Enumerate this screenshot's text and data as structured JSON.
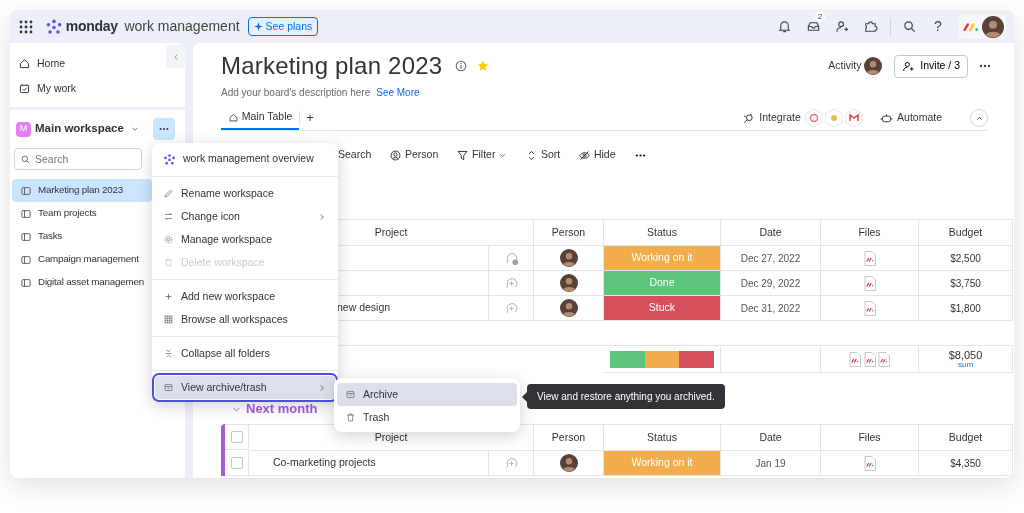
{
  "top_bar": {
    "brand": "monday",
    "product": "work management",
    "plans_button": "See plans",
    "inbox_badge": "2",
    "help": "?"
  },
  "sidebar": {
    "nav": [
      {
        "label": "Home"
      },
      {
        "label": "My work"
      }
    ],
    "workspace": {
      "initial": "M",
      "name": "Main workspace",
      "menu_open": true
    },
    "search": {
      "placeholder": "Search"
    },
    "boards": [
      {
        "label": "Marketing plan 2023",
        "selected": true
      },
      {
        "label": "Team projects",
        "selected": false
      },
      {
        "label": "Tasks",
        "selected": false
      },
      {
        "label": "Campaign management",
        "selected": false
      },
      {
        "label": "Digital asset managemen",
        "selected": false
      }
    ]
  },
  "board": {
    "title": "Marketing plan 2023",
    "starred": true,
    "description": "Add your board's description here",
    "see_more": "See More",
    "activity": "Activity",
    "invite": "Invite / 3",
    "tabs": [
      {
        "label": "Main Table",
        "selected": true
      }
    ],
    "add_tab": "+",
    "integrate": "Integrate",
    "automate": "Automate",
    "toolbar": [
      {
        "label": "Search"
      },
      {
        "label": "Person"
      },
      {
        "label": "Filter"
      },
      {
        "label": "Sort"
      },
      {
        "label": "Hide"
      }
    ]
  },
  "groups": [
    {
      "columns": [
        "Project",
        "Person",
        "Status",
        "Date",
        "Files",
        "Budget"
      ],
      "rows": [
        {
          "updates": true,
          "status": {
            "label": "Working on it",
            "color": "#f2ae4c"
          },
          "date": "Dec 27, 2022",
          "budget": "$2,500"
        },
        {
          "updates": false,
          "status": {
            "label": "Done",
            "color": "#5cc47b"
          },
          "date": "Dec 29, 2022",
          "budget": "$3,750"
        },
        {
          "project": "new design",
          "updates": false,
          "status": {
            "label": "Stuck",
            "color": "#d5505c"
          },
          "date": "Dec 31, 2022",
          "budget": "$1,800"
        }
      ],
      "summary": {
        "status_segments": [
          {
            "color": "#5cc47b"
          },
          {
            "color": "#f2ae4c"
          },
          {
            "color": "#d5505c"
          }
        ],
        "budget": "$8,050",
        "budget_label": "sum"
      }
    },
    {
      "title": "Next month",
      "color": "#a25ddc",
      "all_checked": false,
      "columns": [
        "Project",
        "Person",
        "Status",
        "Date",
        "Files",
        "Budget"
      ],
      "rows": [
        {
          "project": "Co-marketing projects",
          "checked": false,
          "updates": false,
          "status": {
            "label": "Working on it",
            "color": "#f2ae4c"
          },
          "date": "Jan 19",
          "budget": "$4,350"
        }
      ]
    }
  ],
  "workspace_menu": {
    "items": [
      {
        "kind": "header",
        "label": "work management overview"
      },
      {
        "kind": "divider"
      },
      {
        "kind": "item",
        "label": "Rename workspace",
        "disabled": false,
        "submenu": false,
        "selected": false
      },
      {
        "kind": "item",
        "label": "Change icon",
        "disabled": false,
        "submenu": true,
        "selected": false
      },
      {
        "kind": "item",
        "label": "Manage workspace",
        "disabled": false,
        "submenu": false,
        "selected": false
      },
      {
        "kind": "item",
        "label": "Delete workspace",
        "disabled": true,
        "submenu": false,
        "selected": false
      },
      {
        "kind": "divider"
      },
      {
        "kind": "item",
        "label": "Add new workspace",
        "disabled": false,
        "submenu": false,
        "selected": false
      },
      {
        "kind": "item",
        "label": "Browse all workspaces",
        "disabled": false,
        "submenu": false,
        "selected": false
      },
      {
        "kind": "divider"
      },
      {
        "kind": "item",
        "label": "Collapse all folders",
        "disabled": false,
        "submenu": false,
        "selected": false
      },
      {
        "kind": "divider"
      },
      {
        "kind": "item",
        "label": "View archive/trash",
        "disabled": false,
        "submenu": true,
        "selected": true
      }
    ]
  },
  "archive_submenu": {
    "items": [
      {
        "label": "Archive",
        "selected": true
      },
      {
        "label": "Trash",
        "selected": false
      }
    ]
  },
  "tooltip": "View and restore anything you archived."
}
